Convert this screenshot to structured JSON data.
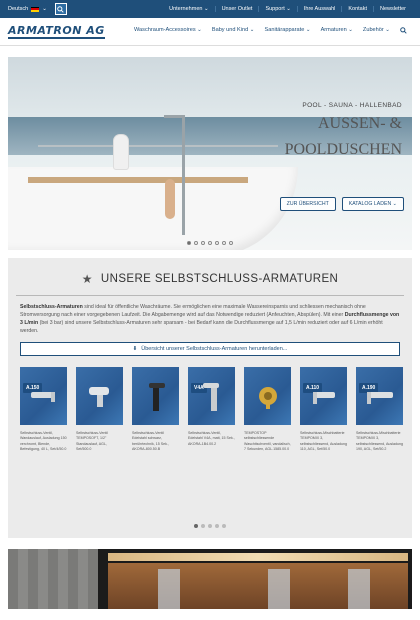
{
  "topbar": {
    "language": "Deutsch",
    "flag_colors": [
      "#000000",
      "#dd0000",
      "#ffce00"
    ],
    "search_icon": "search-icon",
    "links": [
      "Unternehmen ⌄",
      "Unser Outlet",
      "Support ⌄",
      "Ihre Auswahl",
      "Kontakt",
      "Newsletter"
    ]
  },
  "header": {
    "logo": "ARMATRON AG",
    "menu": [
      "Waschraum-Accessoires ⌄",
      "Baby und Kind ⌄",
      "Sanitärapparate ⌄",
      "Armaturen ⌄",
      "Zubehör ⌄"
    ],
    "search_icon": "search-icon"
  },
  "hero": {
    "subtitle": "POOL - SAUNA - HALLENBAD",
    "title_line1": "AUSSEN- &",
    "title_line2": "POOLDUSCHEN",
    "btn_overview": "ZUR ÜBERSICHT",
    "btn_catalog": "KATALOG LADEN ⌄",
    "slides": 7,
    "active_slide": 0
  },
  "section": {
    "title": "UNSERE SELBSTSCHLUSS-ARMATUREN",
    "p_strong1": "Selbstschluss-Armaturen",
    "p_text1": " sind ideal für öffentliche Waschräume. Sie ermöglichen eine maximale Wassereinsparnis und schliessen mechanisch ohne Stromversorgung nach einer vorgegebenen Laufzeit. Die Abgabemenge wird auf das Notwendige reduziert (Anfeuchten, Abspülen). Mit einer ",
    "p_strong2": "Durchflussmenge von 3 L/min",
    "p_text2": " (bei 3 bar) sind unsere Selbstschluss-Armaturen sehr sparsam - bei Bedarf kann die Durchflussmenge auf 1,5 L/min reduziert oder auf 6 L/min erhöht werden.",
    "download": "Übersicht unserer Selbstschluss-Armaturen herunterladen...",
    "products": [
      {
        "badge": "A.150",
        "text": "Selbstschluss-Ventil, Wandauslauf, Ausladung 150 verchromt, Blende, Befestigung, 40 L, Set/4/50.0"
      },
      {
        "badge": "",
        "text": "Selbstschluss-Ventil TEMPOSOFT, 1/2\" Standauslauf, AGL, Set/500.0"
      },
      {
        "badge": "",
        "text": "Selbstschluss-Ventil Edelstahl schwarz, berührtechnik, 15 Sek., AKORA-800.50.B"
      },
      {
        "badge": "V4A",
        "text": "Selbstschluss-Ventil, Edelstahl V4A, matt, 15 Sek., AKORA-1B4.00.2"
      },
      {
        "badge": "",
        "text": "TEMPOSTOP selbstschliessende Waschtischventil, vandalisch, 7 Sekunden, AGL.1585.00.0"
      },
      {
        "badge": "A.110",
        "text": "Selbstschluss-Mischbatterie TEMPOMIX 3, selbstschliessend, Ausladung 110, AGL, Set/50.0"
      },
      {
        "badge": "A.190",
        "text": "Selbstschluss-Mischbatterie TEMPOMIX 3, selbstschliessend, Ausladung 190, AGL, Set/50.2"
      }
    ],
    "pages": 5,
    "active_page": 0
  }
}
